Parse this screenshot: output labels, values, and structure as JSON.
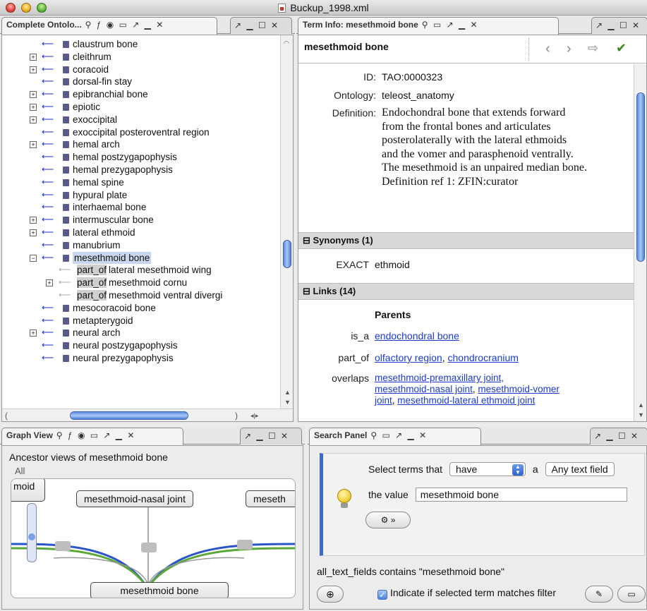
{
  "window": {
    "title": "Buckup_1998.xml"
  },
  "ontology_panel": {
    "tab_label": "Complete Ontolo...",
    "tab_icons": "⚲ ƒ ◉ ▭ ↗ ▁ ✕",
    "tab2_icons": "↗ ▁ ☐ ✕",
    "rows": [
      {
        "label": "claustrum bone",
        "expand": ""
      },
      {
        "label": "cleithrum",
        "expand": "+"
      },
      {
        "label": "coracoid",
        "expand": "+"
      },
      {
        "label": "dorsal-fin stay",
        "expand": ""
      },
      {
        "label": "epibranchial bone",
        "expand": "+"
      },
      {
        "label": "epiotic",
        "expand": "+"
      },
      {
        "label": "exoccipital",
        "expand": "+"
      },
      {
        "label": "exoccipital posteroventral region",
        "expand": ""
      },
      {
        "label": "hemal arch",
        "expand": "+"
      },
      {
        "label": "hemal postzygapophysis",
        "expand": ""
      },
      {
        "label": "hemal prezygapophysis",
        "expand": ""
      },
      {
        "label": "hemal spine",
        "expand": ""
      },
      {
        "label": "hypural plate",
        "expand": ""
      },
      {
        "label": "interhaemal bone",
        "expand": ""
      },
      {
        "label": "intermuscular bone",
        "expand": "+"
      },
      {
        "label": "lateral ethmoid",
        "expand": "+"
      },
      {
        "label": "manubrium",
        "expand": ""
      },
      {
        "label": "mesethmoid bone",
        "expand": "−"
      },
      {
        "label": "mesocoracoid bone",
        "expand": ""
      },
      {
        "label": "metapterygoid",
        "expand": ""
      },
      {
        "label": "neural arch",
        "expand": "+"
      },
      {
        "label": "neural postzygapophysis",
        "expand": ""
      },
      {
        "label": "neural prezygapophysis",
        "expand": ""
      }
    ],
    "relations": [
      {
        "rel": "part_of",
        "label": "lateral mesethmoid wing",
        "expand": ""
      },
      {
        "rel": "part_of",
        "label": "mesethmoid cornu",
        "expand": "+"
      },
      {
        "rel": "part_of",
        "label": "mesethmoid ventral divergi",
        "expand": ""
      }
    ]
  },
  "terminfo_panel": {
    "tab_label": "Term Info: mesethmoid bone",
    "tab_icons": "⚲ ▭ ↗ ▁ ✕",
    "tab2_icons": "↗ ▁ ☐ ✕",
    "term_name": "mesethmoid bone",
    "nav": {
      "back": "‹",
      "forward": "›",
      "ok": "✔"
    },
    "id_label": "ID:",
    "id_value": "TAO:0000323",
    "ontology_label": "Ontology:",
    "ontology_value": "teleost_anatomy",
    "definition_label": "Definition:",
    "definition_lines": [
      "Endochondral bone that extends forward",
      "from the frontal bones and articulates",
      "posterolaterally with the lateral ethmoids",
      "and the vomer and parasphenoid ventrally.",
      "The mesethmoid is an unpaired median bone.",
      "Definition ref 1: ZFIN:curator"
    ],
    "synonyms_header": "⊟ Synonyms (1)",
    "synonym_type": "EXACT",
    "synonym_value": "ethmoid",
    "links_header": "⊟ Links (14)",
    "parents_label": "Parents",
    "is_a_label": "is_a",
    "is_a_link": "endochondral bone",
    "part_of_label": "part_of",
    "part_of_links": [
      "olfactory region",
      "chondrocranium"
    ],
    "overlaps_label": "overlaps",
    "overlaps_links": [
      "mesethmoid-premaxillary joint,",
      "mesethmoid-nasal joint",
      "mesethmoid-vomer",
      "joint",
      "mesethmoid-lateral ethmoid joint"
    ]
  },
  "graph_panel": {
    "tab_label": "Graph View",
    "tab_icons": "⚲ ƒ ◉ ▭ ↗ ▁ ✕",
    "tab2_icons": "↗ ▁ ☐ ✕",
    "caption": "Ancestor views of mesethmoid bone",
    "all_label": "All",
    "nodes": {
      "left": "moid",
      "center": "mesethmoid-nasal joint",
      "right": "meseth",
      "bottom": "mesethmoid bone"
    },
    "edge_colors": {
      "blue": "#2a55c8",
      "green": "#5aa83a"
    }
  },
  "search_panel": {
    "tab_label": "Search Panel",
    "tab_icons": "⚲ ▭ ↗ ▁ ✕",
    "tab2_icons": "↗ ▁ ☐ ✕",
    "select_prefix": "Select terms that",
    "have_value": "have",
    "a_label": "a",
    "field_value": "Any text field",
    "value_label": "the value",
    "value_input": "mesethmoid bone",
    "options_btn": "⚙ »",
    "filter_text": "all_text_fields contains \"mesethmoid bone\"",
    "add_btn": "⊕",
    "checkbox_label": "Indicate if selected term matches filter",
    "checkbox_checked": true,
    "bulb_icon": "lightbulb-icon"
  }
}
